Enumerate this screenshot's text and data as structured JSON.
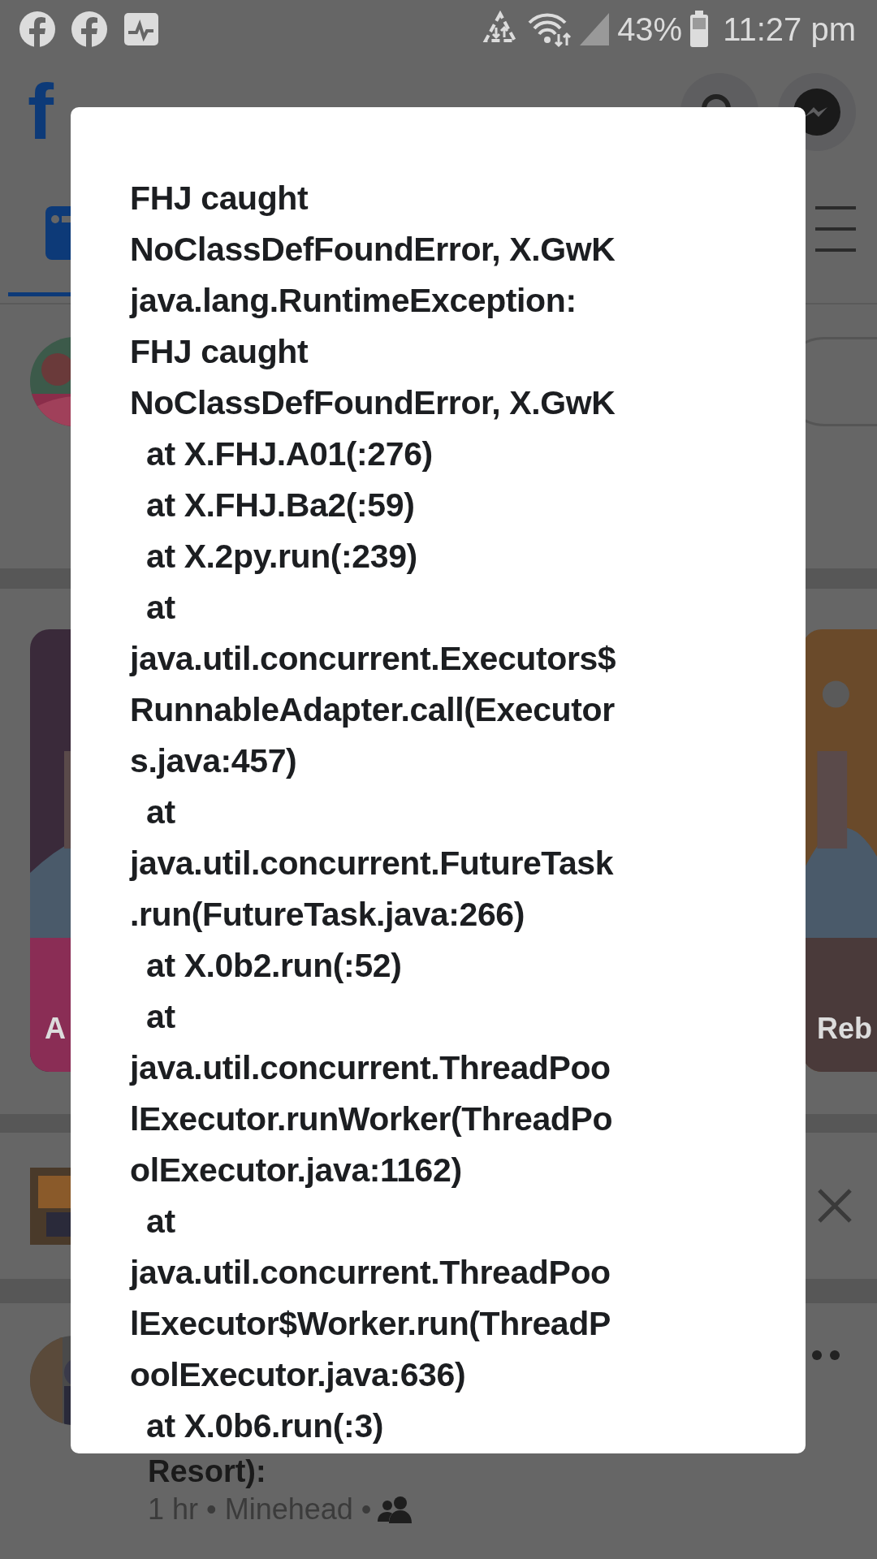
{
  "status_bar": {
    "battery": "43%",
    "time": "11:27 pm"
  },
  "header": {
    "logo": "f"
  },
  "stories": [
    {
      "label": "A"
    },
    {
      "label": "Reb"
    }
  ],
  "post": {
    "title": "Resort):",
    "meta": "1 hr • Minehead •"
  },
  "dialog": {
    "lines": [
      {
        "text": "FHJ caught",
        "indent": false
      },
      {
        "text": "NoClassDefFoundError, X.GwK",
        "indent": false
      },
      {
        "text": "java.lang.RuntimeException:",
        "indent": false
      },
      {
        "text": "FHJ caught",
        "indent": false
      },
      {
        "text": "NoClassDefFoundError, X.GwK",
        "indent": false
      },
      {
        "text": "at X.FHJ.A01(:276)",
        "indent": true
      },
      {
        "text": "at X.FHJ.Ba2(:59)",
        "indent": true
      },
      {
        "text": "at X.2py.run(:239)",
        "indent": true
      },
      {
        "text": "at",
        "indent": true
      },
      {
        "text": "java.util.concurrent.Executors$",
        "indent": false
      },
      {
        "text": "RunnableAdapter.call(Executor",
        "indent": false
      },
      {
        "text": "s.java:457)",
        "indent": false
      },
      {
        "text": "at",
        "indent": true
      },
      {
        "text": "java.util.concurrent.FutureTask",
        "indent": false
      },
      {
        "text": ".run(FutureTask.java:266)",
        "indent": false
      },
      {
        "text": "at X.0b2.run(:52)",
        "indent": true
      },
      {
        "text": "at",
        "indent": true
      },
      {
        "text": "java.util.concurrent.ThreadPoo",
        "indent": false
      },
      {
        "text": "lExecutor.runWorker(ThreadPo",
        "indent": false
      },
      {
        "text": "olExecutor.java:1162)",
        "indent": false
      },
      {
        "text": "at",
        "indent": true
      },
      {
        "text": "java.util.concurrent.ThreadPoo",
        "indent": false
      },
      {
        "text": "lExecutor$Worker.run(ThreadP",
        "indent": false
      },
      {
        "text": "oolExecutor.java:636)",
        "indent": false
      },
      {
        "text": "at X.0b6.run(:3)",
        "indent": true
      }
    ]
  }
}
